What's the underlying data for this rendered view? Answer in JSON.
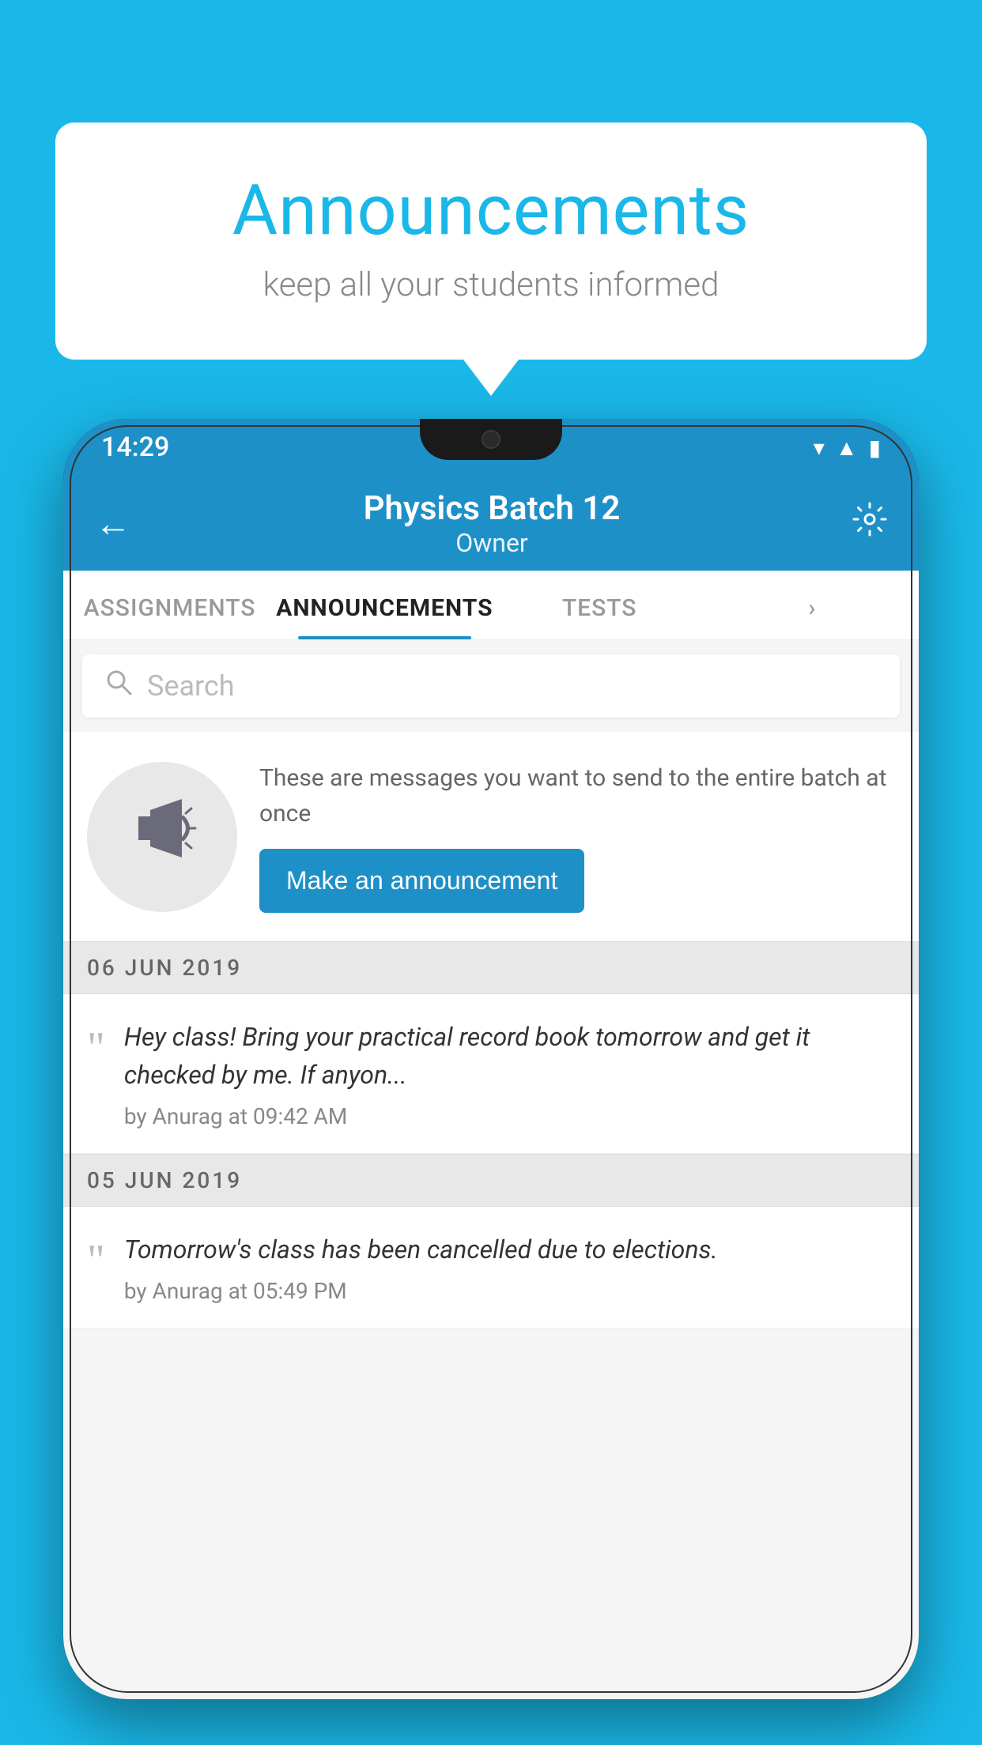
{
  "bubble": {
    "title": "Announcements",
    "subtitle": "keep all your students informed"
  },
  "status_bar": {
    "time": "14:29"
  },
  "app_bar": {
    "title": "Physics Batch 12",
    "subtitle": "Owner",
    "back_label": "←",
    "settings_label": "⚙"
  },
  "tabs": [
    {
      "label": "ASSIGNMENTS",
      "active": false
    },
    {
      "label": "ANNOUNCEMENTS",
      "active": true
    },
    {
      "label": "TESTS",
      "active": false
    },
    {
      "label": "",
      "active": false
    }
  ],
  "search": {
    "placeholder": "Search"
  },
  "announcement_prompt": {
    "description": "These are messages you want to send to the entire batch at once",
    "button_label": "Make an announcement"
  },
  "announcements": [
    {
      "date": "06  JUN  2019",
      "text": "Hey class! Bring your practical record book tomorrow and get it checked by me. If anyon...",
      "meta": "by Anurag at 09:42 AM"
    },
    {
      "date": "05  JUN  2019",
      "text": "Tomorrow's class has been cancelled due to elections.",
      "meta": "by Anurag at 05:49 PM"
    }
  ]
}
